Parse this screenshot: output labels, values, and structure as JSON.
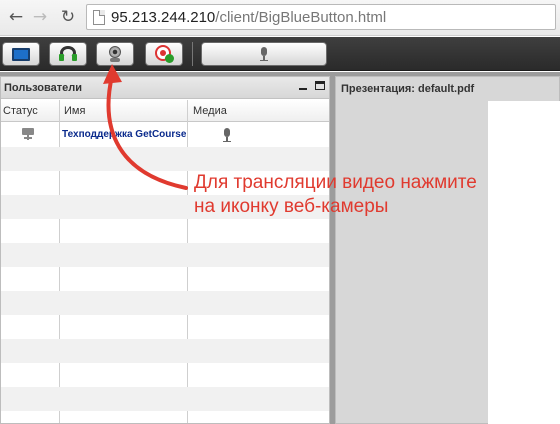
{
  "browser": {
    "back_icon": "back-arrow-icon",
    "forward_icon": "forward-arrow-icon",
    "reload_icon": "reload-icon",
    "url_host": "95.213.244.210",
    "url_path": "/client/BigBlueButton.html"
  },
  "toolbar": {
    "buttons": [
      {
        "icon": "desktop-share-icon"
      },
      {
        "icon": "headset-icon"
      },
      {
        "icon": "webcam-icon"
      },
      {
        "icon": "record-icon"
      },
      {
        "icon": "microphone-icon"
      }
    ]
  },
  "users_panel": {
    "title": "Пользователи",
    "columns": {
      "status": "Статус",
      "name": "Имя",
      "media": "Медиа"
    },
    "users": [
      {
        "name": "Техподдержка GetCourse",
        "status_icon": "presenter-icon",
        "media_icon": "microphone-icon"
      }
    ],
    "empty_rows": 12
  },
  "presentation_panel": {
    "title": "Презентация: default.pdf"
  },
  "annotation": {
    "line1": "Для трансляции видео нажмите",
    "line2": "на иконку веб-камеры",
    "color": "#e03a2f"
  }
}
